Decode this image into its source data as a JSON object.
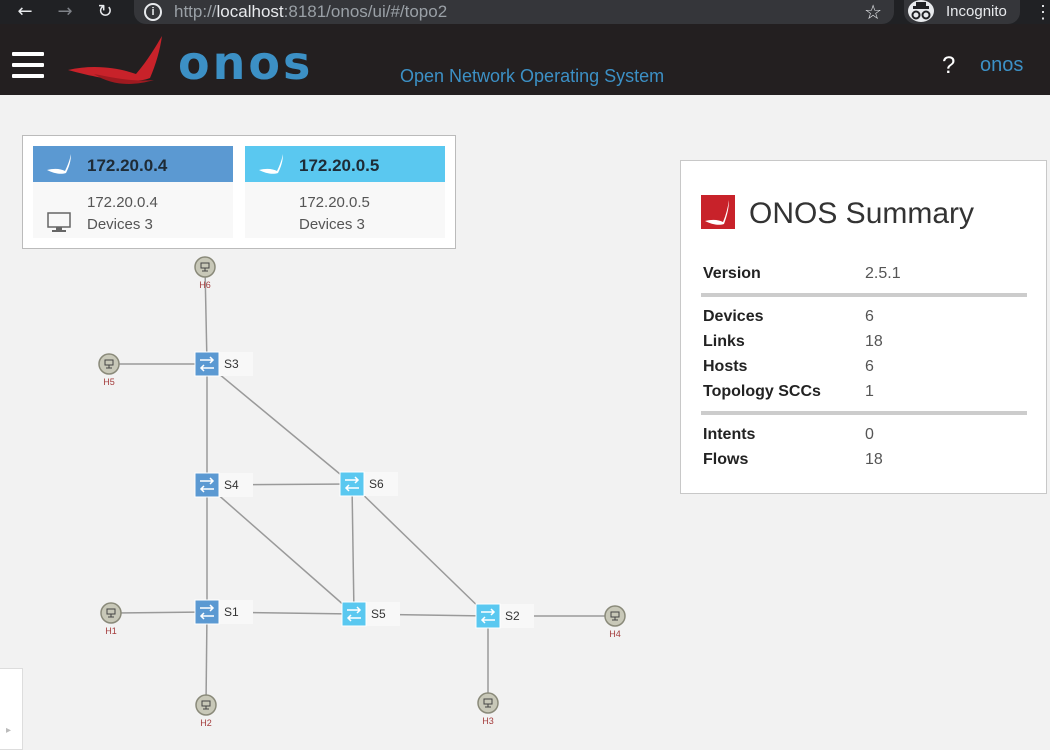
{
  "browser": {
    "url_prefix": "http://",
    "url_host": "localhost",
    "url_rest": ":8181/onos/ui/#/topo2",
    "profile_label": "Incognito"
  },
  "masthead": {
    "logo_text": "onos",
    "tagline": "Open Network Operating System",
    "help_label": "?",
    "user_label": "onos"
  },
  "instances": [
    {
      "name": "172.20.0.4",
      "ip": "172.20.0.4",
      "devices": "Devices 3",
      "color": "#5b99d2"
    },
    {
      "name": "172.20.0.5",
      "ip": "172.20.0.5",
      "devices": "Devices 3",
      "color": "#5ac8f0"
    }
  ],
  "summary": {
    "title": "ONOS Summary",
    "version_label": "Version",
    "version": "2.5.1",
    "devices_label": "Devices",
    "devices": "6",
    "links_label": "Links",
    "links": "18",
    "hosts_label": "Hosts",
    "hosts": "6",
    "sccs_label": "Topology SCCs",
    "sccs": "1",
    "intents_label": "Intents",
    "intents": "0",
    "flows_label": "Flows",
    "flows": "18"
  },
  "topology": {
    "devices": [
      {
        "id": "S1",
        "label": "S1",
        "master": 0
      },
      {
        "id": "S2",
        "label": "S2",
        "master": 1
      },
      {
        "id": "S3",
        "label": "S3",
        "master": 0
      },
      {
        "id": "S4",
        "label": "S4",
        "master": 0
      },
      {
        "id": "S5",
        "label": "S5",
        "master": 1
      },
      {
        "id": "S6",
        "label": "S6",
        "master": 1
      }
    ],
    "hosts": [
      {
        "id": "H1",
        "label": "H1",
        "attached": "S1"
      },
      {
        "id": "H2",
        "label": "H2",
        "attached": "S1"
      },
      {
        "id": "H3",
        "label": "H3",
        "attached": "S2"
      },
      {
        "id": "H4",
        "label": "H4",
        "attached": "S2"
      },
      {
        "id": "H5",
        "label": "H5",
        "attached": "S3"
      },
      {
        "id": "H6",
        "label": "H6",
        "attached": "S3"
      }
    ],
    "links": [
      [
        "S3",
        "S4"
      ],
      [
        "S3",
        "S6"
      ],
      [
        "S4",
        "S6"
      ],
      [
        "S4",
        "S1"
      ],
      [
        "S4",
        "S5"
      ],
      [
        "S6",
        "S5"
      ],
      [
        "S6",
        "S2"
      ],
      [
        "S1",
        "S5"
      ],
      [
        "S5",
        "S2"
      ]
    ],
    "colors": {
      "link": "#9a9a9a",
      "host_fill": "#c8c8b8",
      "host_stroke": "#8a8a7a"
    }
  }
}
